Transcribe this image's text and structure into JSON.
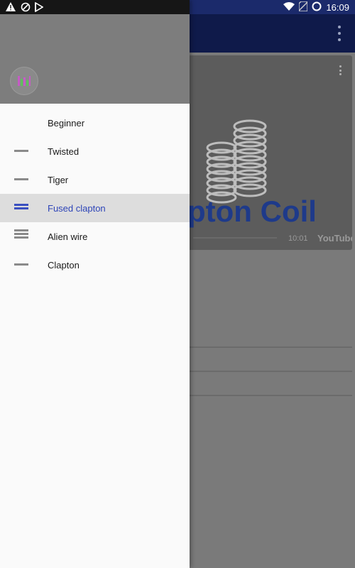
{
  "status_bar": {
    "time": "16:09",
    "left_icons": [
      "warning-icon",
      "rotation-blocked-icon",
      "download-icon"
    ],
    "right_icons": [
      "wifi-icon",
      "no-sim-icon",
      "battery-icon"
    ]
  },
  "app_bar": {
    "overflow_icon": "more-vert-icon",
    "color": "#0f1a4a"
  },
  "video": {
    "title_fragment": "pton Coil",
    "duration": "10:01",
    "source": "YouTube"
  },
  "drawer": {
    "logo_icon": "app-logo-icon",
    "accent_color": "#2e45b8",
    "items": [
      {
        "label": "Beginner",
        "icon": "none",
        "selected": false
      },
      {
        "label": "Twisted",
        "icon": "single-bar-icon",
        "selected": false
      },
      {
        "label": "Tiger",
        "icon": "single-bar-icon",
        "selected": false
      },
      {
        "label": "Fused clapton",
        "icon": "double-bar-icon",
        "selected": true
      },
      {
        "label": "Alien wire",
        "icon": "triple-bar-icon",
        "selected": false
      },
      {
        "label": "Clapton",
        "icon": "single-bar-icon",
        "selected": false
      }
    ]
  }
}
